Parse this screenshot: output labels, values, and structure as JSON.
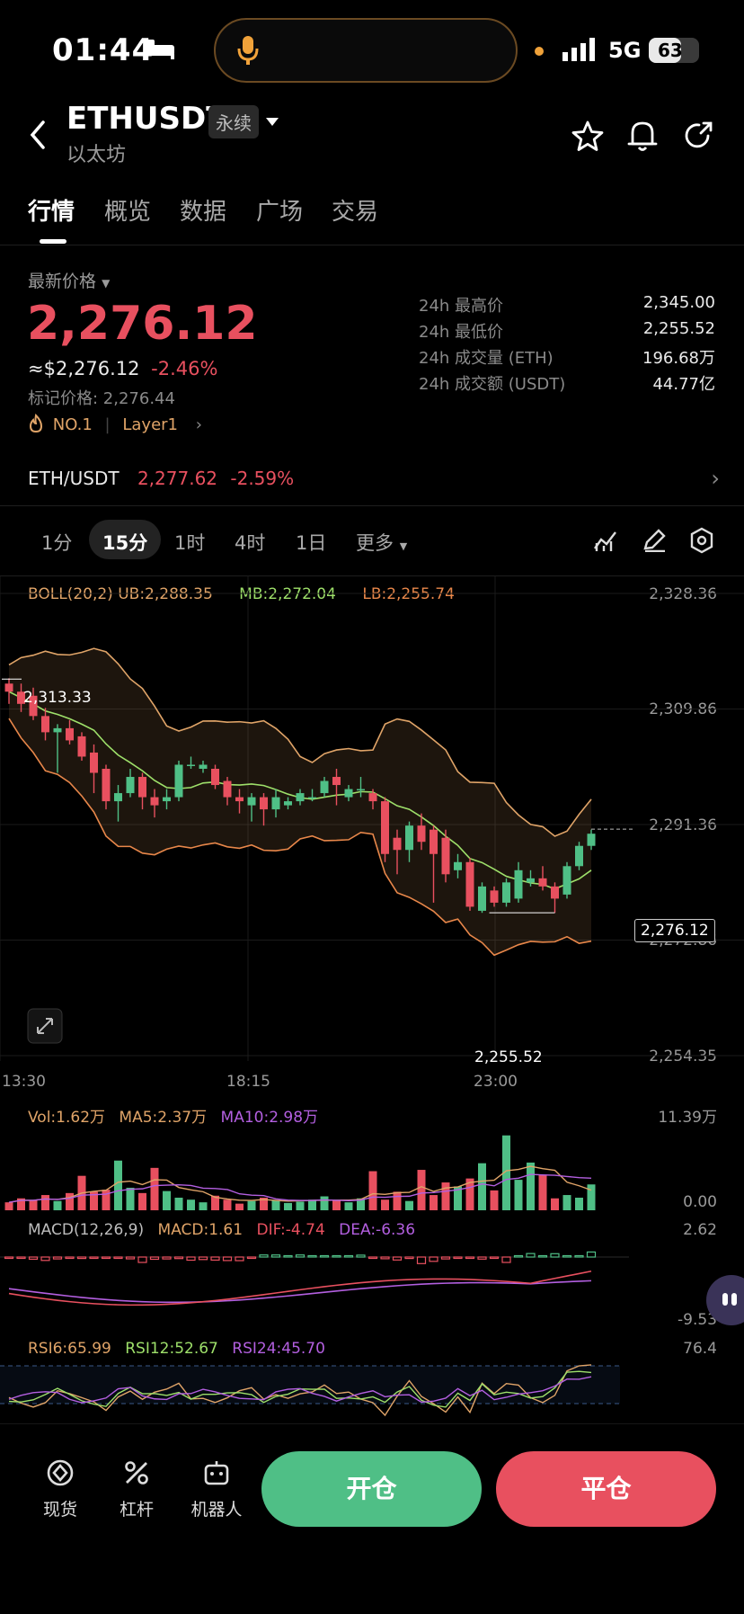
{
  "status_bar": {
    "time": "01:44",
    "network": "5G",
    "battery": "63"
  },
  "header": {
    "title": "ETHUSDT",
    "badge": "永续",
    "subtitle": "以太坊",
    "tabs": [
      {
        "label": "行情"
      },
      {
        "label": "概览"
      },
      {
        "label": "数据"
      },
      {
        "label": "广场"
      },
      {
        "label": "交易"
      }
    ]
  },
  "price": {
    "label": "最新价格",
    "last": "2,276.12",
    "usd_equiv": "≈$2,276.12",
    "change_pct": "-2.46%",
    "mark": "标记价格: 2,276.44",
    "rank": "NO.1",
    "category": "Layer1",
    "stats": [
      {
        "label": "24h 最高价",
        "value": "2,345.00"
      },
      {
        "label": "24h 最低价",
        "value": "2,255.52"
      },
      {
        "label": "24h 成交量 (ETH)",
        "value": "196.68万"
      },
      {
        "label": "24h 成交额 (USDT)",
        "value": "44.77亿"
      }
    ]
  },
  "pair": {
    "name": "ETH/USDT",
    "price": "2,277.62",
    "change": "-2.59%"
  },
  "timeframes": {
    "items": [
      "1分",
      "15分",
      "1时",
      "4时",
      "1日"
    ],
    "active": "15分",
    "more": "更多"
  },
  "indicators": {
    "boll": {
      "name": "BOLL(20,2)",
      "ub": "UB:2,288.35",
      "mb": "MB:2,272.04",
      "lb": "LB:2,255.74"
    },
    "vol": {
      "name": "Vol:1.62万",
      "ma5": "MA5:2.37万",
      "ma10": "MA10:2.98万",
      "axis_top": "11.39万",
      "axis_bottom": "0.00"
    },
    "macd": {
      "name": "MACD(12,26,9)",
      "macd": "MACD:1.61",
      "dif": "DIF:-4.74",
      "dea": "DEA:-6.36",
      "axis_top": "2.62",
      "axis_bottom": "-9.53"
    },
    "rsi": {
      "rsi6": "RSI6:65.99",
      "rsi12": "RSI12:52.67",
      "rsi24": "RSI24:45.70",
      "axis_top": "76.4"
    }
  },
  "chart_data": {
    "type": "candlestick",
    "price_axis": [
      "2,328.36",
      "2,309.86",
      "2,291.36",
      "2,272.86",
      "2,254.35"
    ],
    "time_axis": [
      "13:30",
      "18:15",
      "23:00"
    ],
    "high_label": "2,313.33",
    "low_label": "2,255.52",
    "last_label": "2,276.12",
    "ylim": [
      2250,
      2332
    ],
    "candles": [
      {
        "o": 2312.0,
        "c": 2310.0,
        "h": 2313.3,
        "l": 2307.0
      },
      {
        "o": 2310.0,
        "c": 2307.0,
        "h": 2312.0,
        "l": 2305.0
      },
      {
        "o": 2309.0,
        "c": 2304.0,
        "h": 2311.0,
        "l": 2303.0
      },
      {
        "o": 2304.0,
        "c": 2300.0,
        "h": 2306.0,
        "l": 2298.0
      },
      {
        "o": 2300.0,
        "c": 2301.0,
        "h": 2302.0,
        "l": 2290.0
      },
      {
        "o": 2301.0,
        "c": 2298.0,
        "h": 2303.0,
        "l": 2297.0
      },
      {
        "o": 2299.0,
        "c": 2294.0,
        "h": 2300.0,
        "l": 2293.0
      },
      {
        "o": 2295.0,
        "c": 2290.0,
        "h": 2297.0,
        "l": 2285.0
      },
      {
        "o": 2291.0,
        "c": 2283.0,
        "h": 2292.0,
        "l": 2281.0
      },
      {
        "o": 2283.0,
        "c": 2285.0,
        "h": 2287.0,
        "l": 2278.0
      },
      {
        "o": 2285.0,
        "c": 2289.0,
        "h": 2291.0,
        "l": 2284.0
      },
      {
        "o": 2289.0,
        "c": 2284.0,
        "h": 2290.0,
        "l": 2281.0
      },
      {
        "o": 2284.0,
        "c": 2282.0,
        "h": 2286.0,
        "l": 2279.0
      },
      {
        "o": 2283.0,
        "c": 2284.0,
        "h": 2286.0,
        "l": 2281.0
      },
      {
        "o": 2284.0,
        "c": 2292.0,
        "h": 2293.0,
        "l": 2283.0
      },
      {
        "o": 2292.0,
        "c": 2292.0,
        "h": 2294.0,
        "l": 2291.0
      },
      {
        "o": 2291.0,
        "c": 2292.0,
        "h": 2293.0,
        "l": 2290.0
      },
      {
        "o": 2291.0,
        "c": 2287.0,
        "h": 2292.0,
        "l": 2286.0
      },
      {
        "o": 2288.0,
        "c": 2284.0,
        "h": 2289.0,
        "l": 2282.0
      },
      {
        "o": 2284.0,
        "c": 2283.0,
        "h": 2286.0,
        "l": 2280.0
      },
      {
        "o": 2282.0,
        "c": 2284.0,
        "h": 2285.0,
        "l": 2278.0
      },
      {
        "o": 2284.0,
        "c": 2281.0,
        "h": 2285.0,
        "l": 2277.0
      },
      {
        "o": 2281.0,
        "c": 2284.0,
        "h": 2286.0,
        "l": 2279.0
      },
      {
        "o": 2282.0,
        "c": 2283.0,
        "h": 2284.0,
        "l": 2281.0
      },
      {
        "o": 2283.0,
        "c": 2285.0,
        "h": 2286.0,
        "l": 2282.0
      },
      {
        "o": 2284.0,
        "c": 2284.0,
        "h": 2286.0,
        "l": 2283.0
      },
      {
        "o": 2285.0,
        "c": 2288.0,
        "h": 2289.0,
        "l": 2284.0
      },
      {
        "o": 2289.0,
        "c": 2287.0,
        "h": 2291.0,
        "l": 2282.0
      },
      {
        "o": 2284.0,
        "c": 2286.0,
        "h": 2287.0,
        "l": 2283.0
      },
      {
        "o": 2286.0,
        "c": 2286.0,
        "h": 2289.0,
        "l": 2284.0
      },
      {
        "o": 2285.0,
        "c": 2283.0,
        "h": 2286.0,
        "l": 2281.0
      },
      {
        "o": 2283.0,
        "c": 2270.0,
        "h": 2284.0,
        "l": 2268.0
      },
      {
        "o": 2274.0,
        "c": 2271.0,
        "h": 2276.0,
        "l": 2265.0
      },
      {
        "o": 2271.0,
        "c": 2277.0,
        "h": 2278.0,
        "l": 2268.0
      },
      {
        "o": 2277.0,
        "c": 2273.0,
        "h": 2280.0,
        "l": 2271.0
      },
      {
        "o": 2276.0,
        "c": 2270.0,
        "h": 2277.0,
        "l": 2258.0
      },
      {
        "o": 2274.0,
        "c": 2265.0,
        "h": 2276.0,
        "l": 2263.0
      },
      {
        "o": 2266.0,
        "c": 2268.0,
        "h": 2270.0,
        "l": 2264.0
      },
      {
        "o": 2268.0,
        "c": 2257.0,
        "h": 2269.0,
        "l": 2256.0
      },
      {
        "o": 2256.0,
        "c": 2262.0,
        "h": 2263.0,
        "l": 2255.5
      },
      {
        "o": 2261.0,
        "c": 2258.0,
        "h": 2262.0,
        "l": 2257.0
      },
      {
        "o": 2258.0,
        "c": 2263.0,
        "h": 2264.0,
        "l": 2257.0
      },
      {
        "o": 2259.0,
        "c": 2266.0,
        "h": 2268.0,
        "l": 2258.0
      },
      {
        "o": 2263.0,
        "c": 2264.0,
        "h": 2266.0,
        "l": 2262.0
      },
      {
        "o": 2264.0,
        "c": 2262.0,
        "h": 2267.0,
        "l": 2261.0
      },
      {
        "o": 2262.0,
        "c": 2259.0,
        "h": 2263.0,
        "l": 2255.5
      },
      {
        "o": 2260.0,
        "c": 2267.0,
        "h": 2268.0,
        "l": 2259.0
      },
      {
        "o": 2267.0,
        "c": 2272.0,
        "h": 2273.0,
        "l": 2266.0
      },
      {
        "o": 2272.0,
        "c": 2275.0,
        "h": 2276.0,
        "l": 2271.0
      }
    ]
  }
}
